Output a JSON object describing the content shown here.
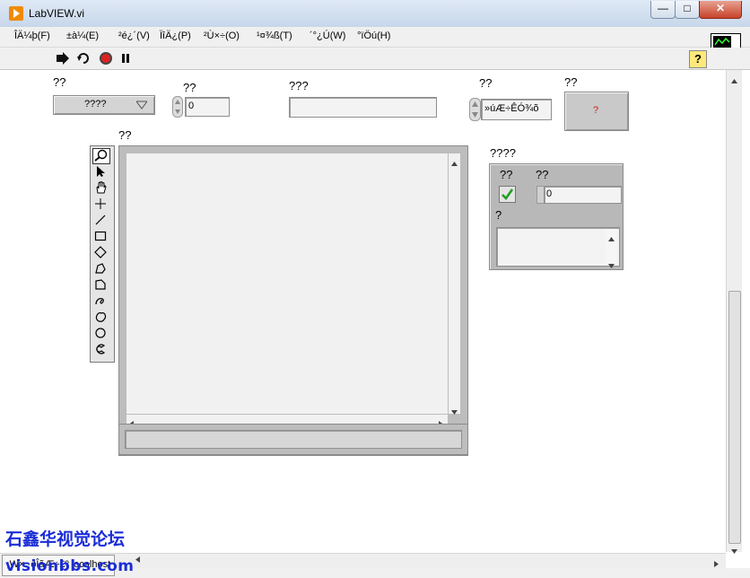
{
  "window": {
    "title": "LabVIEW.vi",
    "minimize": "—",
    "maximize": "□",
    "close": "✕"
  },
  "menu": [
    "ÎÄ¼þ(F)",
    "±à¼­(E)",
    "²é¿´(V)",
    "ÏîÄ¿(P)",
    "²Ù×÷(O)",
    "¹¤¾ß(T)",
    "´°¿Ú(W)",
    "°ïÖú(H)"
  ],
  "toolbar": {
    "icons": [
      "run-arrow-icon",
      "run-continuously-icon",
      "abort-icon",
      "pause-icon"
    ],
    "help": "?"
  },
  "controls": {
    "combo": {
      "label": "??",
      "value": "????"
    },
    "numeric": {
      "label": "??",
      "value": "0"
    },
    "string": {
      "label": "???",
      "value": ""
    },
    "ring": {
      "label": "??",
      "value": "»úÆ÷ÊÓ¾õ"
    },
    "button": {
      "label": "??",
      "text": "?"
    },
    "picture": {
      "label": "??"
    },
    "cluster": {
      "label": "????",
      "bool_label": "??",
      "num_label": "??",
      "num_value": "0",
      "str_label": "?"
    }
  },
  "palette_tools": [
    "zoom-icon",
    "pointer-icon",
    "hand-icon",
    "crosshair-icon",
    "line-icon",
    "rectangle-icon",
    "diamond-icon",
    "polygon-icon",
    "freehand-polygon-icon",
    "curve-icon",
    "blob-icon",
    "circle-icon",
    "arc-icon"
  ],
  "status": {
    "target": "¡W× ·ðÎãÆ÷£º localhost"
  },
  "watermark": {
    "line1": "石鑫华视觉论坛",
    "line2": "visionbbs.com"
  }
}
